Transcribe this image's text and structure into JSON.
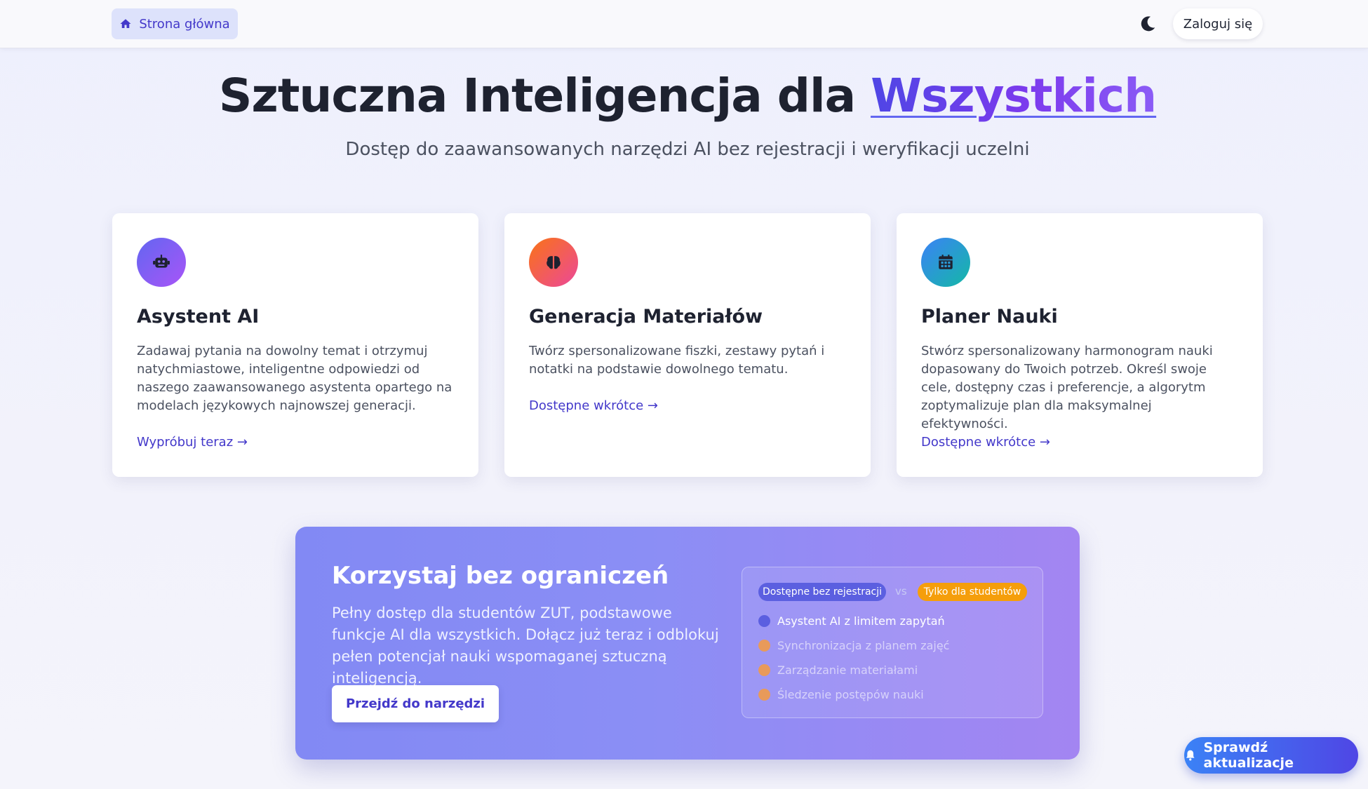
{
  "header": {
    "home_label": "Strona główna",
    "login_label": "Zaloguj się",
    "icons": {
      "home": "home-icon",
      "theme": "moon-icon"
    }
  },
  "hero": {
    "title_prefix": "Sztuczna Inteligencja dla ",
    "title_accent": "Wszystkich",
    "subtitle": "Dostęp do zaawansowanych narzędzi AI bez rejestracji i weryfikacji uczelni"
  },
  "cards": [
    {
      "icon": "robot-icon",
      "title": "Asystent AI",
      "desc": "Zadawaj pytania na dowolny temat i otrzymuj natychmiastowe, inteligentne odpowiedzi od naszego zaawansowanego asystenta opartego na modelach językowych najnowszej generacji.",
      "link": "Wypróbuj teraz →"
    },
    {
      "icon": "brain-icon",
      "title": "Generacja Materiałów",
      "desc": "Twórz spersonalizowane fiszki, zestawy pytań i notatki na podstawie dowolnego tematu.",
      "link": "Dostępne wkrótce →"
    },
    {
      "icon": "calendar-icon",
      "title": "Planer Nauki",
      "desc": "Stwórz spersonalizowany harmonogram nauki dopasowany do Twoich potrzeb. Określ swoje cele, dostępny czas i preferencje, a algorytm zoptymalizuje plan dla maksymalnej efektywności.",
      "link": "Dostępne wkrótce →"
    }
  ],
  "cta": {
    "title": "Korzystaj bez ograniczeń",
    "desc": "Pełny dostęp dla studentów ZUT, podstawowe funkcje AI dla wszystkich. Dołącz już teraz i odblokuj pełen potencjał nauki wspomaganej sztuczną inteligencją.",
    "button": "Przejdź do narzędzi",
    "compare": {
      "badge_free": "Dostępne bez rejestracji",
      "vs": "vs",
      "badge_students": "Tylko dla studentów",
      "features": [
        {
          "label": "Asystent AI z limitem zapytań",
          "tier": "free"
        },
        {
          "label": "Synchronizacja z planem zajęć",
          "tier": "students"
        },
        {
          "label": "Zarządzanie materiałami",
          "tier": "students"
        },
        {
          "label": "Śledzenie postępów nauki",
          "tier": "students"
        }
      ]
    }
  },
  "update_button": "Sprawdź aktualizacje",
  "colors": {
    "accent": "#4338ca",
    "free_dot": "#5b5fe0",
    "student_dot": "#e89a5a"
  }
}
